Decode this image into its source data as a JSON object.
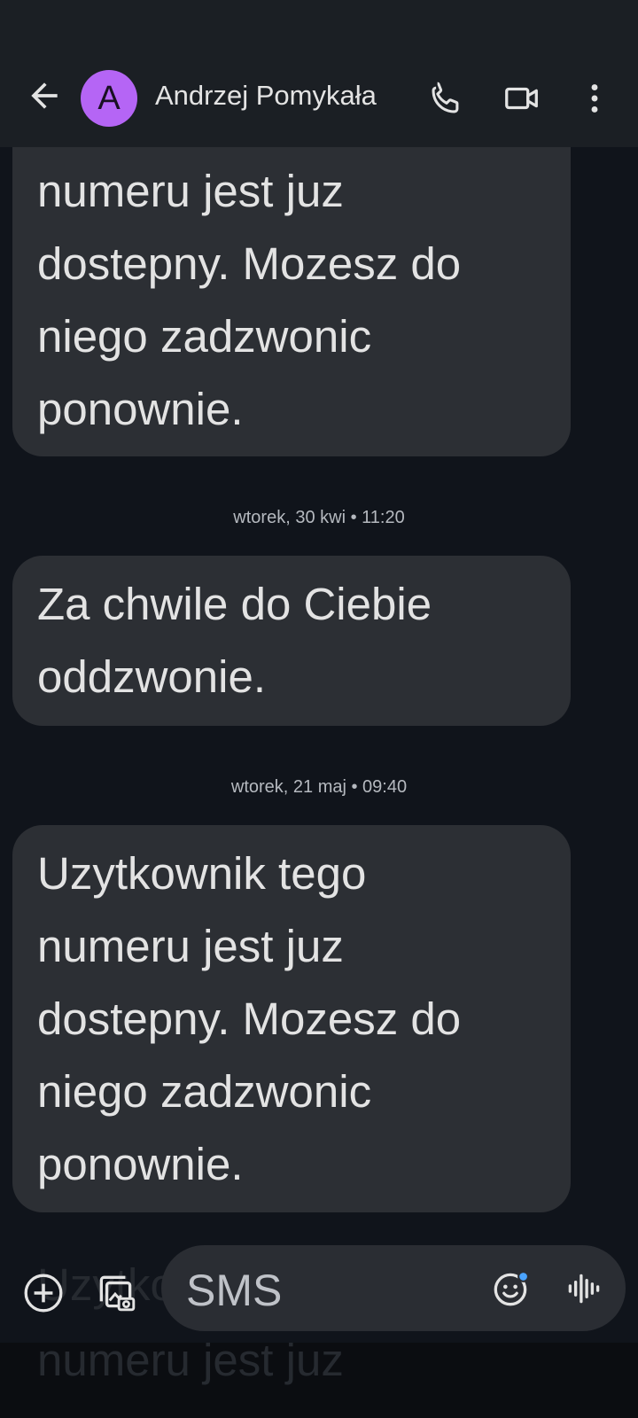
{
  "header": {
    "avatar_letter": "A",
    "contact_name": "Andrzej Pomykała",
    "avatar_color": "#b565f5"
  },
  "messages": [
    {
      "lines": [
        "numeru jest juz",
        "dostepny. Mozesz do",
        "niego zadzwonic",
        "ponownie."
      ]
    },
    {
      "timestamp": "wtorek, 30 kwi • 11:20",
      "lines": [
        "Za chwile do Ciebie",
        "oddzwonie."
      ]
    },
    {
      "timestamp": "wtorek, 21 maj • 09:40",
      "lines": [
        "Uzytkownik tego",
        "numeru jest juz",
        "dostepny. Mozesz do",
        "niego zadzwonic",
        "ponownie."
      ]
    }
  ],
  "behind_composer": [
    "Uzytkownik tego",
    "numeru jest juz"
  ],
  "composer": {
    "placeholder": "SMS"
  },
  "icons": {
    "back": "arrow-back-icon",
    "call": "phone-icon",
    "video": "video-camera-icon",
    "more": "more-vert-icon",
    "add": "add-circle-icon",
    "gallery": "gallery-icon",
    "emoji": "emoji-icon",
    "voice": "voice-waveform-icon"
  },
  "colors": {
    "background": "#10141b",
    "bubble": "#2c2f34",
    "appbar": "#1b1f24",
    "accent_dot": "#4aa3ff"
  }
}
